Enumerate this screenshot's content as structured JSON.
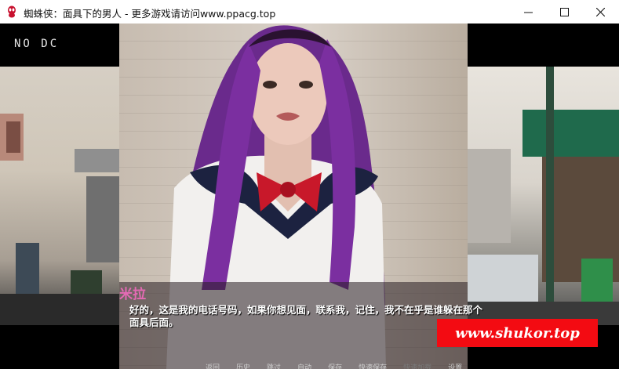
{
  "window": {
    "title": "蜘蛛侠：面具下的男人 - 更多游戏请访问www.ppacg.top",
    "icon": "spider-app-icon",
    "controls": [
      "minimize-icon",
      "maximize-icon",
      "close-icon"
    ]
  },
  "game": {
    "logo": "NO DC",
    "speaker": "米拉",
    "dialogue": "好的，这是我的电话号码，如果你想见面，联系我，记住，我不在乎是谁躲在那个面具后面。",
    "watermark": "www.shukor.top",
    "quick_menu": [
      "返回",
      "历史",
      "跳过",
      "自动",
      "保存",
      "快速保存",
      "快速加载",
      "设置"
    ],
    "colors": {
      "speaker": "#e46ab4",
      "watermark_bg": "#f30b12"
    }
  }
}
